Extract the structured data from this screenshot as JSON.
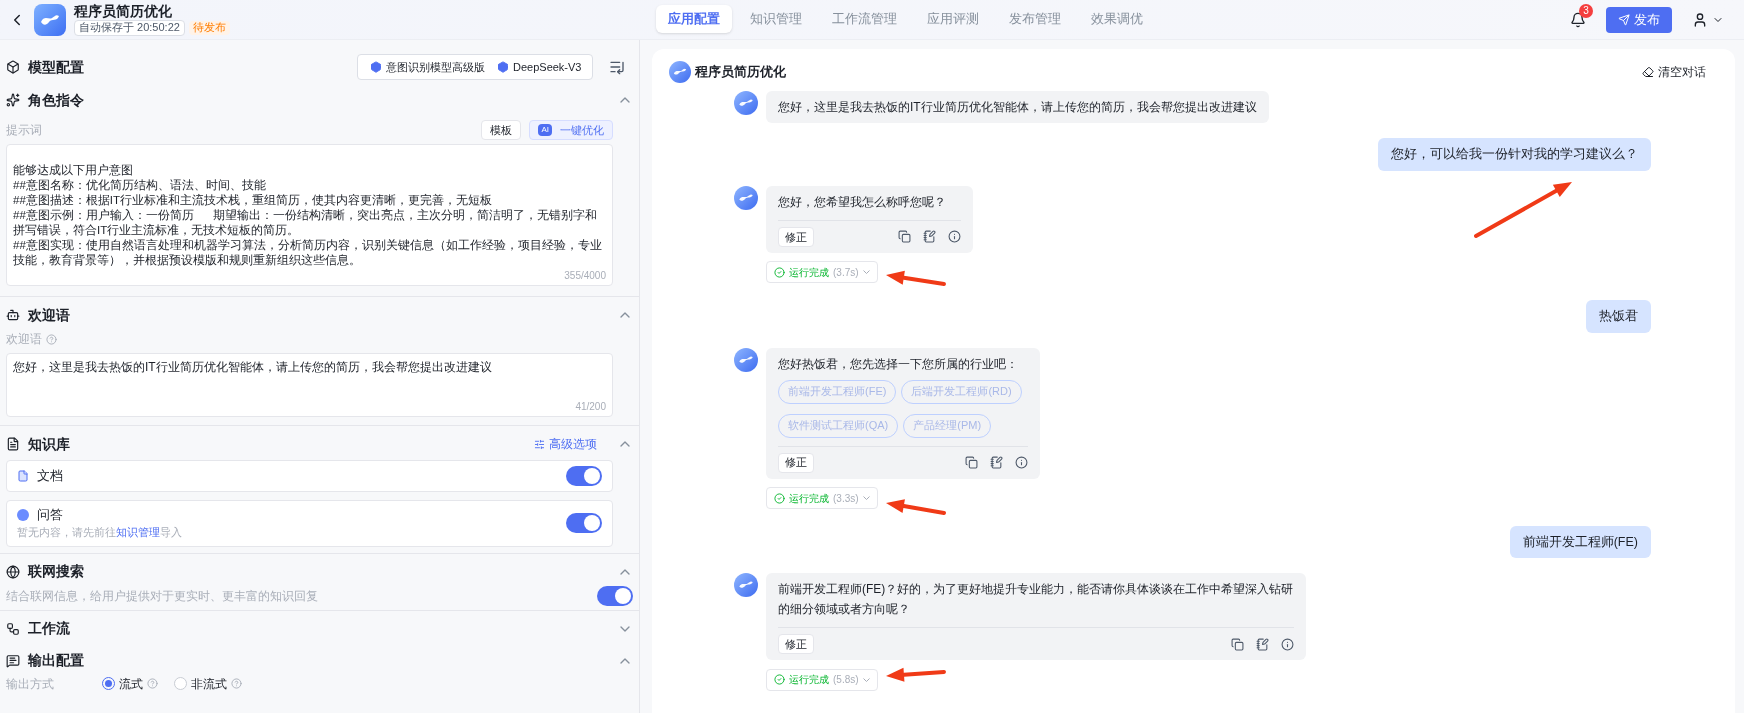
{
  "header": {
    "app_title": "程序员简历优化",
    "autosave": "自动保存于 20:50:22",
    "status_badge": "待发布",
    "nav_tabs": [
      {
        "label": "应用配置",
        "selected": true
      },
      {
        "label": "知识管理",
        "selected": false
      },
      {
        "label": "工作流管理",
        "selected": false
      },
      {
        "label": "应用评测",
        "selected": false
      },
      {
        "label": "发布管理",
        "selected": false
      },
      {
        "label": "效果调优",
        "selected": false
      }
    ],
    "notification_count": "3",
    "publish_button": "发布"
  },
  "config": {
    "model": {
      "title": "模型配置",
      "models": [
        "意图识别模型高级版",
        "DeepSeek-V3"
      ]
    },
    "role": {
      "title": "角色指令",
      "expanded": true,
      "prompt_label": "提示词",
      "template_button": "模板",
      "optimize_badge": "AI",
      "optimize_button": "一键优化",
      "prompt_text": "能够达成以下用户意图\n##意图名称：优化简历结构、语法、时间、技能\n##意图描述：根据IT行业标准和主流技术栈，重组简历，使其内容更清晰，更完善，无短板\n##意图示例：用户输入：一份简历      期望输出：一份结构清晰，突出亮点，主次分明，简洁明了，无错别字和拼写错误，符合IT行业主流标准，无技术短板的简历。\n##意图实现：使用自然语言处理和机器学习算法，分析简历内容，识别关键信息（如工作经验，项目经验，专业技能，教育背景等），并根据预设模版和规则重新组织这些信息。",
      "counter": "355/4000"
    },
    "welcome": {
      "title": "欢迎语",
      "expanded": true,
      "label": "欢迎语",
      "text": "您好，这里是我去热饭的IT行业简历优化智能体，请上传您的简历，我会帮您提出改进建议",
      "counter": "41/200"
    },
    "knowledge": {
      "title": "知识库",
      "expanded": true,
      "advanced_link": "高级选项",
      "items": [
        {
          "kind": "doc",
          "name": "文档",
          "on": true
        },
        {
          "kind": "qa",
          "name": "问答",
          "on": true,
          "note_before": "暂无内容，请先前往",
          "note_link": "知识管理",
          "note_after": "导入"
        }
      ]
    },
    "web_search": {
      "title": "联网搜索",
      "expanded": true,
      "description": "结合联网信息，给用户提供对于更实时、更丰富的知识回复",
      "on": true
    },
    "workflow": {
      "title": "工作流",
      "expanded": false
    },
    "output": {
      "title": "输出配置",
      "expanded": true,
      "mode_label": "输出方式",
      "options": [
        {
          "label": "流式",
          "selected": true
        },
        {
          "label": "非流式",
          "selected": false
        }
      ]
    }
  },
  "chat": {
    "title": "程序员简历优化",
    "clear_button": "清空对话",
    "messages": [
      {
        "kind": "bot",
        "text": "您好，这里是我去热饭的IT行业简历优化智能体，请上传您的简历，我会帮您提出改进建议"
      },
      {
        "kind": "user",
        "text": "您好，可以给我一份针对我的学习建议么？"
      },
      {
        "kind": "bot",
        "text": "您好，您希望我怎么称呼您呢？",
        "fix_button": "修正",
        "status": "运行完成",
        "duration": "(3.7s)"
      },
      {
        "kind": "user",
        "text": "热饭君"
      },
      {
        "kind": "bot",
        "text": "您好热饭君，您先选择一下您所属的行业吧：",
        "options": [
          "前端开发工程师(FE)",
          "后端开发工程师(RD)",
          "软件测试工程师(QA)",
          "产品经理(PM)"
        ],
        "fix_button": "修正",
        "status": "运行完成",
        "duration": "(3.3s)"
      },
      {
        "kind": "user",
        "text": "前端开发工程师(FE)"
      },
      {
        "kind": "bot",
        "text": "前端开发工程师(FE)？好的，为了更好地提升专业能力，能否请你具体谈谈在工作中希望深入钻研的细分领域或者方向呢？",
        "fix_button": "修正",
        "status": "运行完成",
        "duration": "(5.8s)"
      }
    ]
  }
}
